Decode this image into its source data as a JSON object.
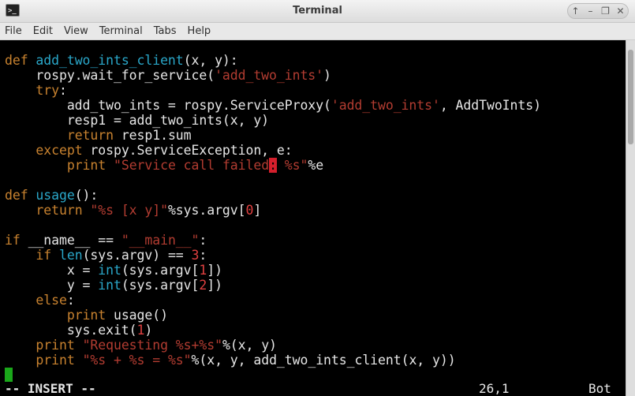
{
  "window": {
    "title": "Terminal"
  },
  "window_controls": [
    "↑",
    "–",
    "❐",
    "✕"
  ],
  "menu": [
    "File",
    "Edit",
    "View",
    "Terminal",
    "Tabs",
    "Help"
  ],
  "code_lines": [
    "def add_two_ints_client(x, y):",
    "    rospy.wait_for_service('add_two_ints')",
    "    try:",
    "        add_two_ints = rospy.ServiceProxy('add_two_ints', AddTwoInts)",
    "        resp1 = add_two_ints(x, y)",
    "        return resp1.sum",
    "    except rospy.ServiceException, e:",
    "        print \"Service call failed: %s\"%e",
    "",
    "def usage():",
    "    return \"%s [x y]\"%sys.argv[0]",
    "",
    "if __name__ == \"__main__\":",
    "    if len(sys.argv) == 3:",
    "        x = int(sys.argv[1])",
    "        y = int(sys.argv[2])",
    "    else:",
    "        print usage()",
    "        sys.exit(1)",
    "    print \"Requesting %s+%s\"%(x, y)",
    "    print \"%s + %s = %s\"%(x, y, add_two_ints_client(x, y))",
    ""
  ],
  "status": {
    "mode": "-- INSERT --",
    "position": "26,1",
    "scroll": "Bot"
  },
  "colors": {
    "keyword": "#c8822f",
    "function": "#2aa7c9",
    "string": "#b23c31",
    "cursor": "#1aa71a"
  }
}
